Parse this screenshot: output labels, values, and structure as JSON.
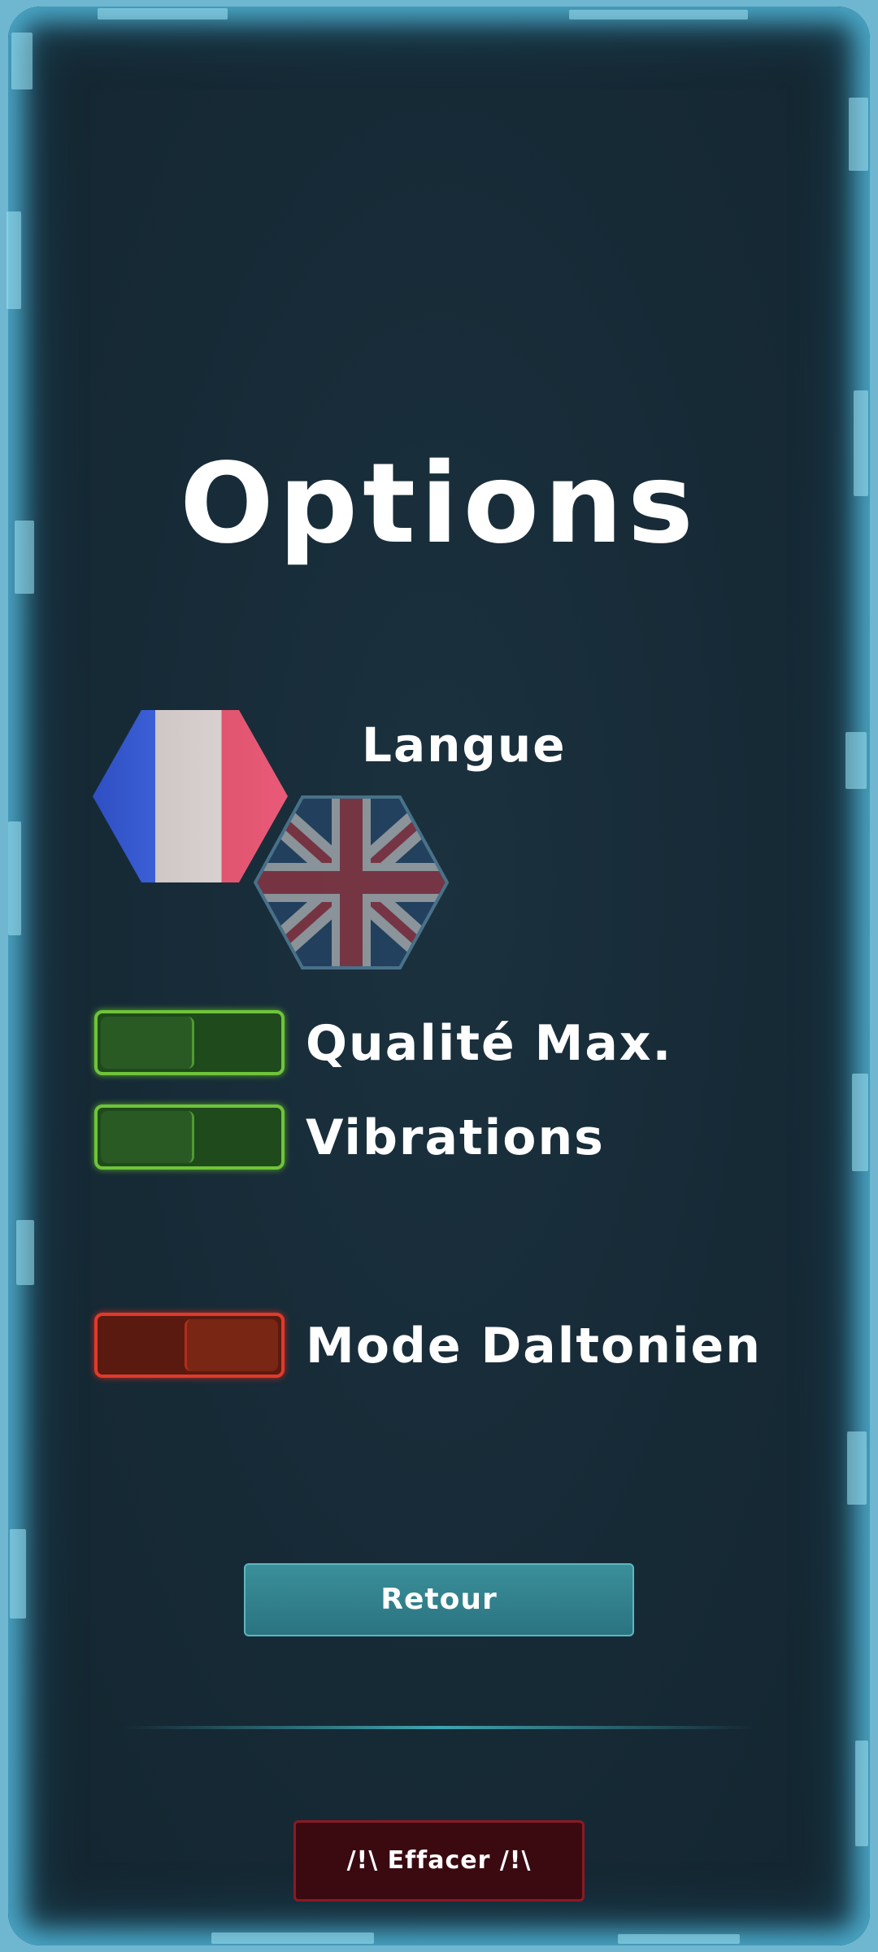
{
  "title": "Options",
  "language": {
    "label": "Langue",
    "flags": [
      {
        "name": "french-flag",
        "selected": true
      },
      {
        "name": "uk-flag",
        "selected": false
      }
    ]
  },
  "toggles": {
    "quality": {
      "label": "Qualité Max.",
      "state": "on"
    },
    "vibrations": {
      "label": "Vibrations",
      "state": "on"
    },
    "colorblind": {
      "label": "Mode Daltonien",
      "state": "off"
    }
  },
  "buttons": {
    "back": "Retour",
    "erase": "/!\\ Effacer /!\\"
  },
  "colors": {
    "toggle_on": "#6fc43a",
    "toggle_off": "#e03a2a",
    "back_button": "#2a7480",
    "erase_button": "#3a0a10",
    "frame_glow": "#4aa6c6"
  }
}
